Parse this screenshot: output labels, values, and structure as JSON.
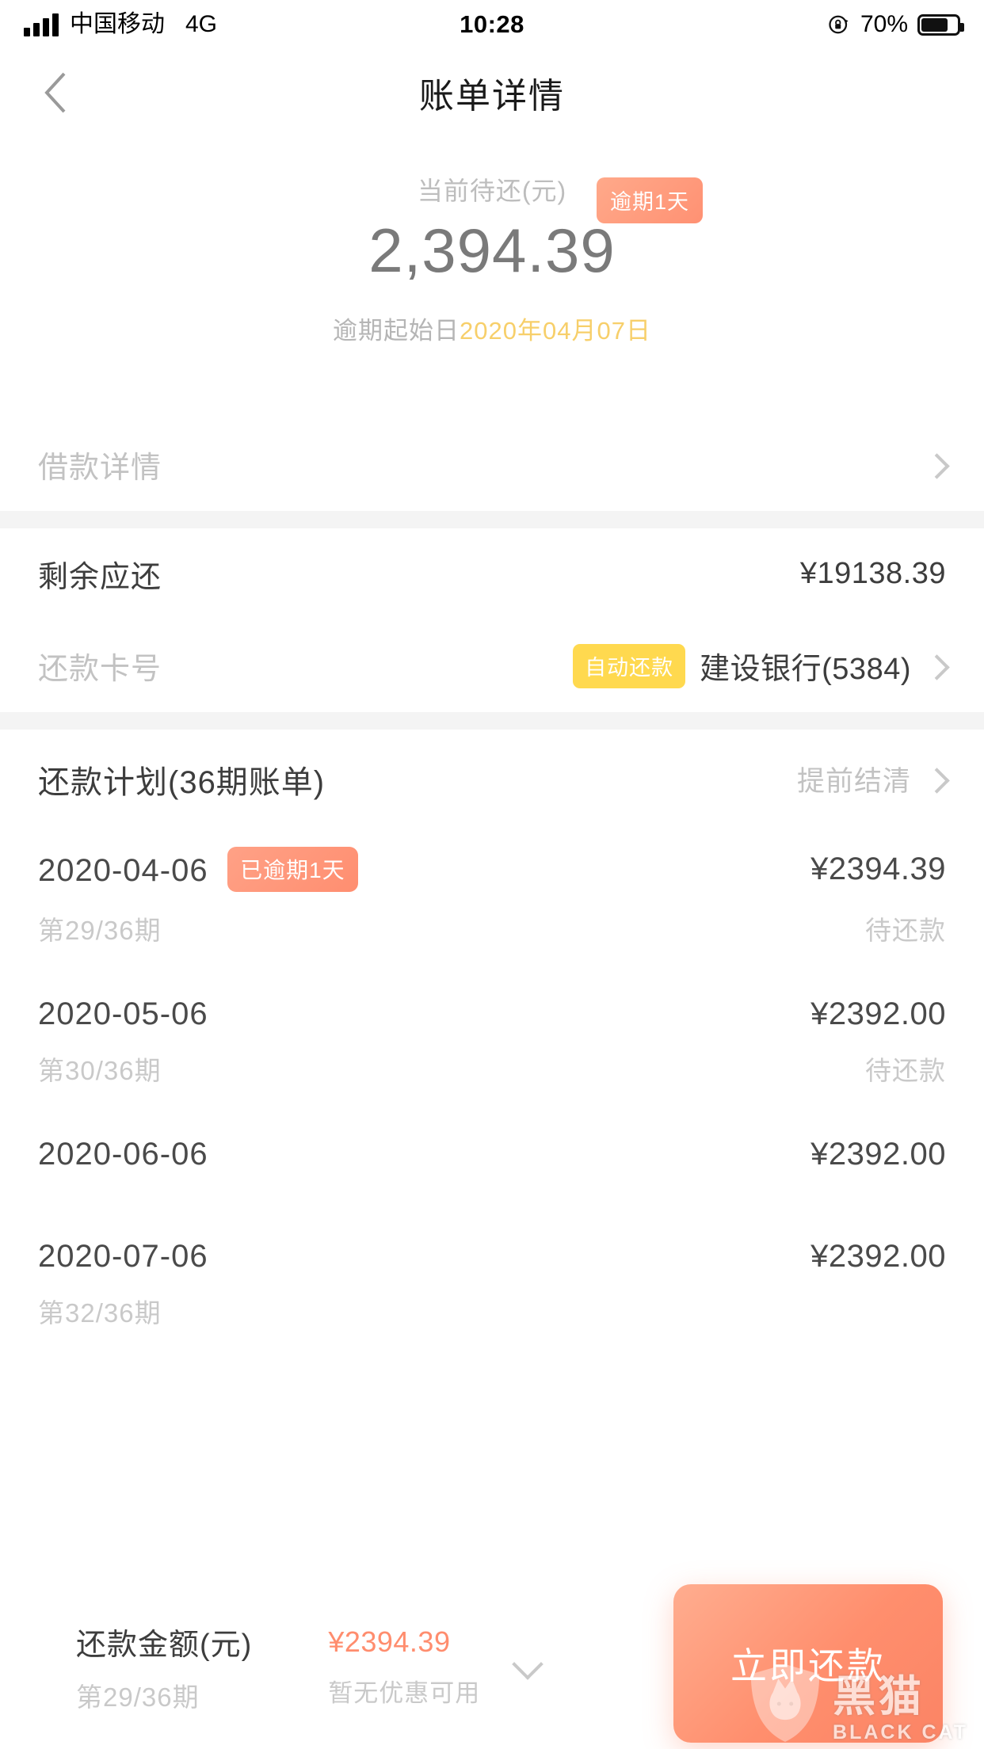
{
  "status_bar": {
    "carrier": "中国移动",
    "network": "4G",
    "time": "10:28",
    "battery_percent": "70%",
    "rotation_lock_icon": "rotation-lock-icon",
    "signal_icon": "signal-bars-icon",
    "battery_icon": "battery-icon"
  },
  "nav": {
    "back_icon": "chevron-left-icon",
    "title": "账单详情"
  },
  "hero": {
    "label": "当前待还(元)",
    "amount": "2,394.39",
    "overdue_badge": "逾期1天",
    "overdue_start_label": "逾期起始日",
    "overdue_start_date": "2020年04月07日"
  },
  "loan_detail": {
    "label": "借款详情",
    "chevron_icon": "chevron-right-icon"
  },
  "remaining": {
    "label": "剩余应还",
    "value": "¥19138.39"
  },
  "repay_card": {
    "label": "还款卡号",
    "auto_badge": "自动还款",
    "bank": "建设银行(5384)",
    "chevron_icon": "chevron-right-icon"
  },
  "plan": {
    "title": "还款计划(36期账单)",
    "action": "提前结清",
    "chevron_icon": "chevron-right-icon",
    "installments": [
      {
        "date": "2020-04-06",
        "badge": "已逾期1天",
        "term": "第29/36期",
        "amount": "¥2394.39",
        "state": "待还款"
      },
      {
        "date": "2020-05-06",
        "badge": "",
        "term": "第30/36期",
        "amount": "¥2392.00",
        "state": "待还款"
      },
      {
        "date": "2020-06-06",
        "badge": "",
        "term": "",
        "amount": "¥2392.00",
        "state": ""
      },
      {
        "date": "2020-07-06",
        "badge": "",
        "term": "第32/36期",
        "amount": "¥2392.00",
        "state": ""
      }
    ]
  },
  "paybar": {
    "amount_label": "还款金额(元)",
    "term": "第29/36期",
    "amount": "¥2394.39",
    "coupon_note": "暂无优惠可用",
    "expand_icon": "chevron-down-icon",
    "button_label": "立即还款"
  },
  "watermark": {
    "cn": "黑猫",
    "en": "BLACK CAT",
    "icon": "black-cat-shield-icon"
  },
  "colors": {
    "accent_orange": "#ff8e6d",
    "badge_yellow": "#ffd94f",
    "date_gold": "#f7cf6a",
    "text_dark": "#3d3d3d",
    "text_muted": "#c2c2c2",
    "divider_gray": "#f4f4f4"
  }
}
